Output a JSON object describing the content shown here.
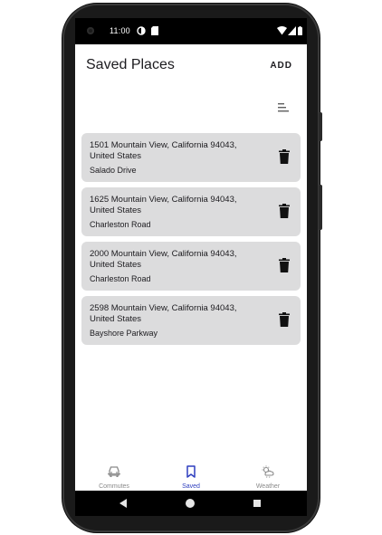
{
  "status_bar": {
    "time": "11:00",
    "icons": [
      "camera-dot-icon",
      "theme-icon",
      "sim-card-icon",
      "wifi-icon",
      "signal-icon",
      "battery-icon"
    ]
  },
  "app_bar": {
    "title": "Saved Places",
    "add_label": "ADD"
  },
  "toolbar": {
    "sort_icon": "sort-icon"
  },
  "places": [
    {
      "address_line1": "1501 Mountain View, California 94043,",
      "address_line2": "United States",
      "street": "Salado Drive"
    },
    {
      "address_line1": "1625 Mountain View, California 94043,",
      "address_line2": "United States",
      "street": "Charleston Road"
    },
    {
      "address_line1": "2000 Mountain View, California 94043,",
      "address_line2": "United States",
      "street": "Charleston Road"
    },
    {
      "address_line1": "2598 Mountain View, California 94043,",
      "address_line2": "United States",
      "street": "Bayshore Parkway"
    }
  ],
  "bottom_nav": {
    "items": [
      {
        "label": "Commutes",
        "icon": "car-icon",
        "active": false
      },
      {
        "label": "Saved",
        "icon": "bookmark-icon",
        "active": true
      },
      {
        "label": "Weather",
        "icon": "weather-icon",
        "active": false
      }
    ]
  },
  "colors": {
    "card_bg": "#dcdcdd",
    "active_nav": "#2f3fbf",
    "inactive_nav": "#8a8a8a",
    "phone_frame": "#1a1a1a"
  }
}
